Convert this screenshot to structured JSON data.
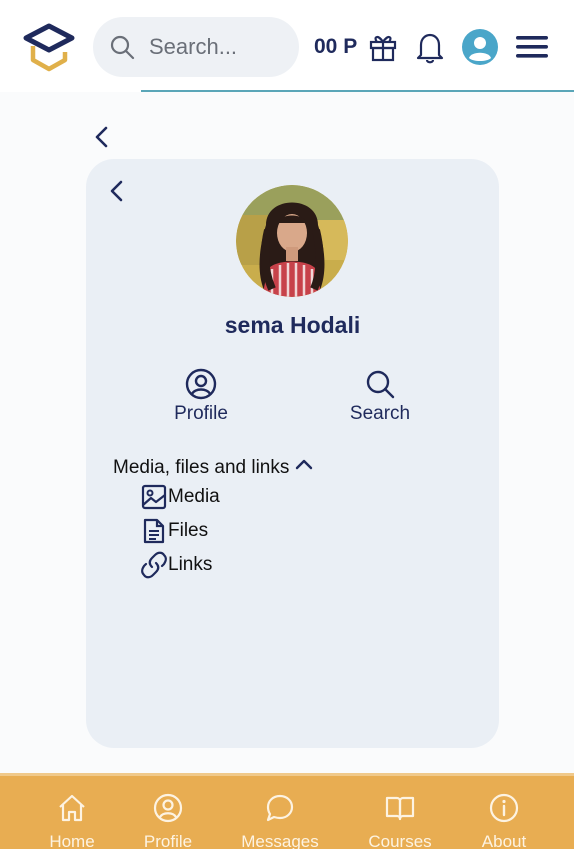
{
  "header": {
    "search_placeholder": "Search...",
    "points": "00 P",
    "icons": [
      "graduation-cap-logo",
      "search-icon",
      "gift-icon",
      "bell-icon",
      "user-avatar-icon",
      "menu-icon"
    ]
  },
  "profile": {
    "name": "sema Hodali",
    "actions": [
      {
        "label": "Profile",
        "icon": "user-circle-icon"
      },
      {
        "label": "Search",
        "icon": "search-icon"
      }
    ],
    "section_title": "Media, files and links",
    "items": [
      {
        "label": "Media",
        "icon": "image-icon"
      },
      {
        "label": "Files",
        "icon": "file-text-icon"
      },
      {
        "label": "Links",
        "icon": "link-icon"
      }
    ]
  },
  "bottom_nav": [
    {
      "label": "Home",
      "icon": "home-icon"
    },
    {
      "label": "Profile",
      "icon": "user-circle-icon"
    },
    {
      "label": "Messages",
      "icon": "message-icon"
    },
    {
      "label": "Courses",
      "icon": "book-icon"
    },
    {
      "label": "About",
      "icon": "info-icon"
    }
  ],
  "colors": {
    "primary": "#1f2a5c",
    "accent": "#e8ad52",
    "card": "#eaeff5",
    "avatar": "#4aa6c9",
    "logo_gold": "#e0b04a"
  }
}
